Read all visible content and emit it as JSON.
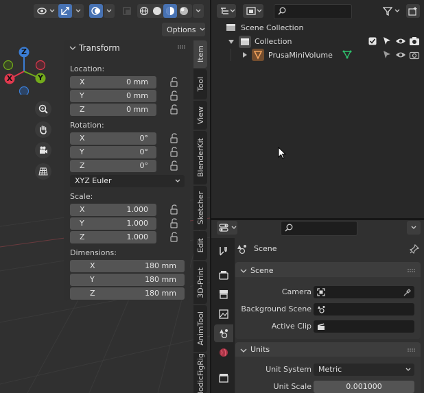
{
  "viewport": {
    "header": {
      "options_label": "Options",
      "icons": [
        "view-toggle-icon",
        "gizmo-icon",
        "overlay-icon",
        "xray-icon",
        "shading-wireframe-icon",
        "shading-solid-icon",
        "shading-material-icon",
        "shading-rendered-icon"
      ]
    },
    "gizmo_axes": {
      "x": "X",
      "y": "Y",
      "z": "Z"
    },
    "nav_icons": [
      "zoom-icon",
      "hand-icon",
      "camera-icon",
      "grid-icon"
    ]
  },
  "npanel": {
    "title": "Transform",
    "location": {
      "label": "Location:",
      "x": "0 mm",
      "y": "0 mm",
      "z": "0 mm"
    },
    "rotation": {
      "label": "Rotation:",
      "x": "0°",
      "y": "0°",
      "z": "0°"
    },
    "rotation_mode": "XYZ Euler",
    "scale": {
      "label": "Scale:",
      "x": "1.000",
      "y": "1.000",
      "z": "1.000"
    },
    "dimensions": {
      "label": "Dimensions:",
      "x": "180 mm",
      "y": "180 mm",
      "z": "180 mm"
    },
    "axis": {
      "x": "X",
      "y": "Y",
      "z": "Z"
    }
  },
  "sidebar_tabs": [
    "Item",
    "Tool",
    "View",
    "BlenderKit",
    "Sketcher",
    "Edit",
    "3D-Print",
    "AnimTool",
    "ModicFigRig"
  ],
  "outliner": {
    "root": "Scene Collection",
    "collection": "Collection",
    "object": "PrusaMiniVolume"
  },
  "properties": {
    "context_title": "Scene",
    "scene_panel": {
      "title": "Scene",
      "camera_label": "Camera",
      "background_scene_label": "Background Scene",
      "active_clip_label": "Active Clip"
    },
    "units_panel": {
      "title": "Units",
      "unit_system_label": "Unit System",
      "unit_system_value": "Metric",
      "unit_scale_label": "Unit Scale",
      "unit_scale_value": "0.001000"
    }
  },
  "colors": {
    "accent": "#4772b3",
    "axis_x": "#e0394e",
    "axis_y": "#73ab1b",
    "axis_z": "#3b7ed6"
  }
}
